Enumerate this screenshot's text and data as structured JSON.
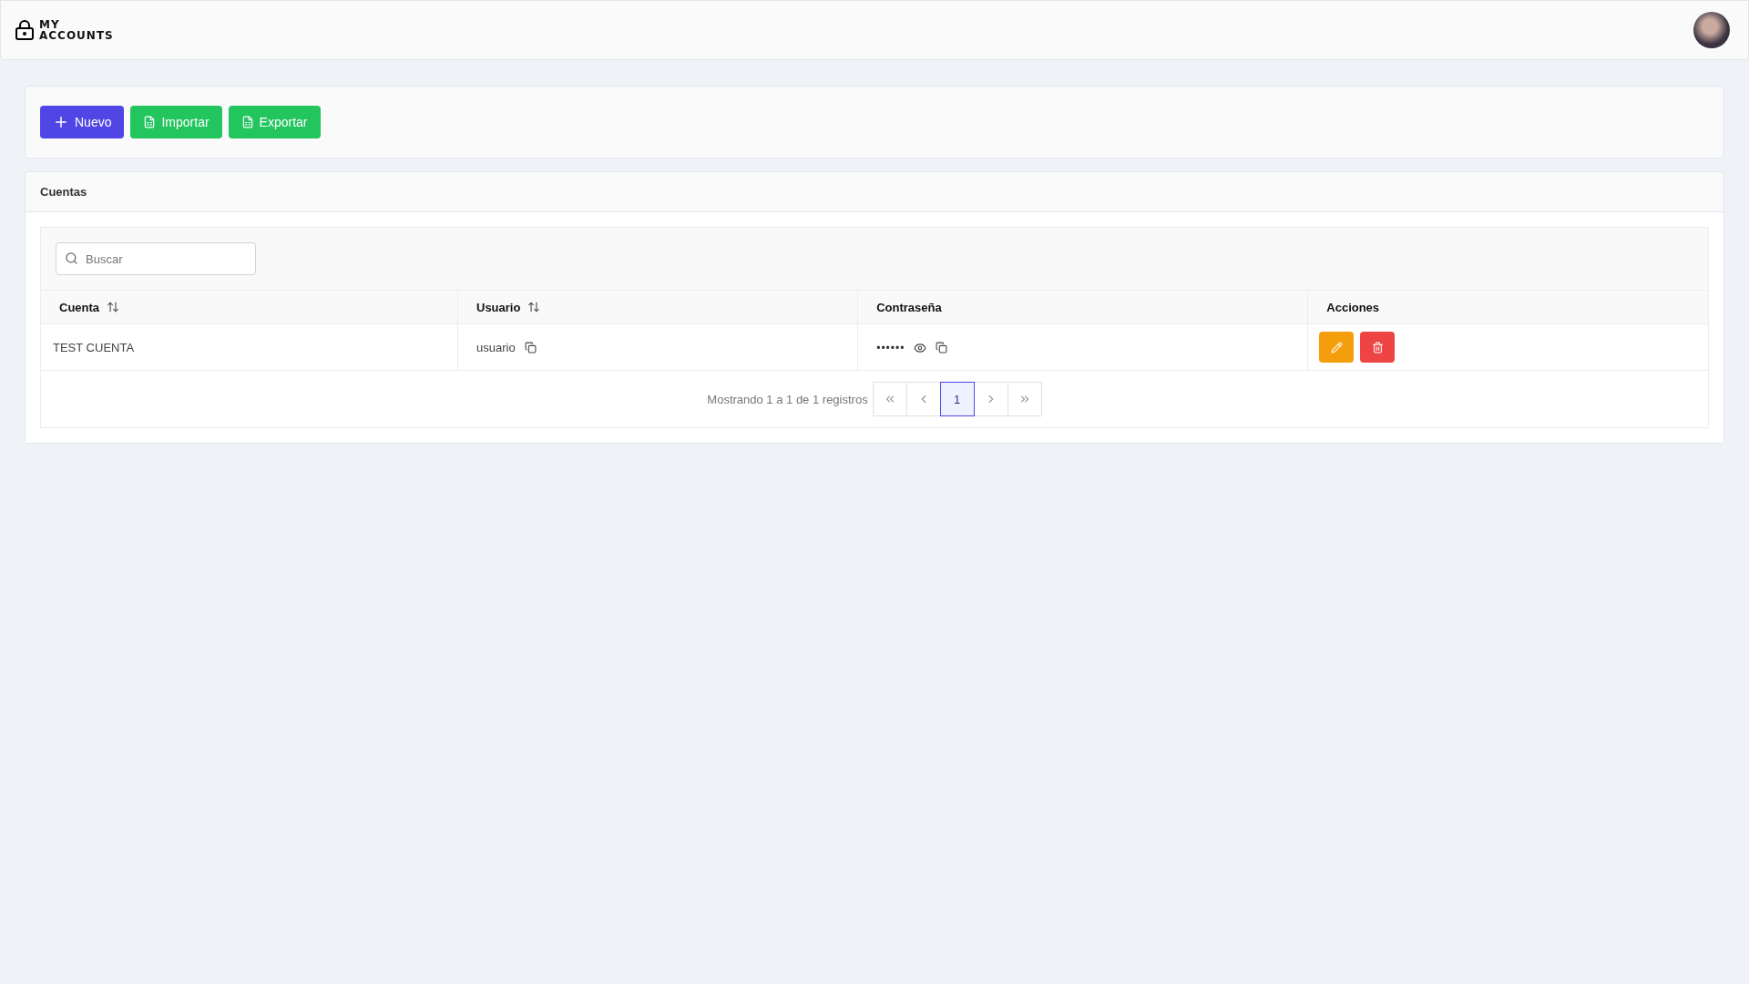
{
  "brand": {
    "line_1": "MY",
    "line_2": "ACCOUNTS"
  },
  "toolbar": [
    {
      "kind": "new",
      "label": "Nuevo"
    },
    {
      "kind": "import",
      "label": "Importar"
    },
    {
      "kind": "export",
      "label": "Exportar"
    }
  ],
  "card": {
    "title": "Cuentas"
  },
  "search": {
    "placeholder": "Buscar"
  },
  "table": {
    "columns": [
      {
        "label": "Cuenta",
        "sortable": true
      },
      {
        "label": "Usuario",
        "sortable": true
      },
      {
        "label": "Contraseña",
        "sortable": false
      },
      {
        "label": "Acciones",
        "sortable": false
      }
    ],
    "rows": [
      {
        "account": "TEST CUENTA",
        "user": "usuario",
        "password": "••••••"
      }
    ]
  },
  "pagination": {
    "summary": "Mostrando 1 a 1 de 1 registros",
    "pages": [
      {
        "label": "1",
        "selected": true
      }
    ]
  }
}
